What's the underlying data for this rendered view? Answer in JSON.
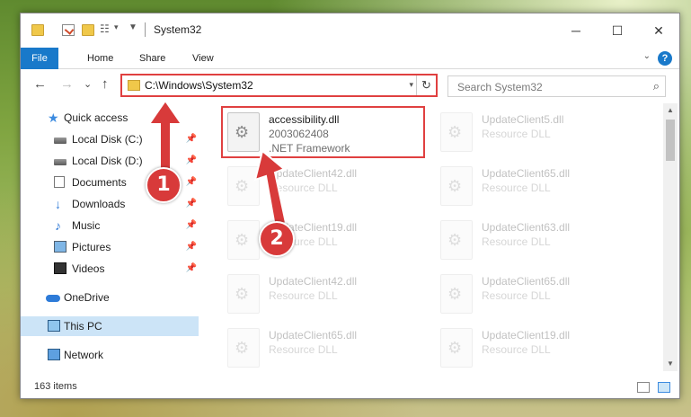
{
  "window": {
    "title": "System32",
    "controls": {
      "minimize": "─",
      "maximize": "☐",
      "close": "✕"
    }
  },
  "ribbon": {
    "tabs": [
      "File",
      "Home",
      "Share",
      "View"
    ],
    "help": "?"
  },
  "navigation": {
    "back": "←",
    "forward": "→",
    "recent": "⌄",
    "up": "↑",
    "address": "C:\\Windows\\System32",
    "search_placeholder": "Search System32"
  },
  "sidebar": {
    "items": [
      {
        "label": "Quick access",
        "icon": "star-icon"
      },
      {
        "label": "Local Disk (C:)",
        "icon": "drive-icon",
        "pinned": true
      },
      {
        "label": "Local Disk (D:)",
        "icon": "drive-icon",
        "pinned": true
      },
      {
        "label": "Documents",
        "icon": "documents-icon",
        "pinned": true
      },
      {
        "label": "Downloads",
        "icon": "downloads-icon",
        "pinned": true
      },
      {
        "label": "Music",
        "icon": "music-icon",
        "pinned": true
      },
      {
        "label": "Pictures",
        "icon": "pictures-icon",
        "pinned": true
      },
      {
        "label": "Videos",
        "icon": "videos-icon",
        "pinned": true
      },
      {
        "label": "OneDrive",
        "icon": "onedrive-icon"
      },
      {
        "label": "This PC",
        "icon": "this-pc-icon",
        "selected": true
      },
      {
        "label": "Network",
        "icon": "network-icon"
      }
    ]
  },
  "files": [
    {
      "name": "accessibility.dll",
      "line2": "2003062408",
      "line3": ".NET Framework",
      "highlighted": true
    },
    {
      "name": "UpdateClient5.dll",
      "line2": "Resource DLL"
    },
    {
      "name": "UpdateClient42.dll",
      "line2": "Resource DLL"
    },
    {
      "name": "UpdateClient65.dll",
      "line2": "Resource DLL"
    },
    {
      "name": "UpdateClient19.dll",
      "line2": "Resource DLL"
    },
    {
      "name": "UpdateClient63.dll",
      "line2": "Resource DLL"
    },
    {
      "name": "UpdateClient42.dll",
      "line2": "Resource DLL"
    },
    {
      "name": "UpdateClient65.dll",
      "line2": "Resource DLL"
    },
    {
      "name": "UpdateClient65.dll",
      "line2": "Resource DLL"
    },
    {
      "name": "UpdateClient19.dll",
      "line2": "Resource DLL"
    }
  ],
  "status": {
    "item_count": "163 items"
  },
  "annotations": {
    "step1": "1",
    "step2": "2",
    "color": "#d83a3a"
  }
}
